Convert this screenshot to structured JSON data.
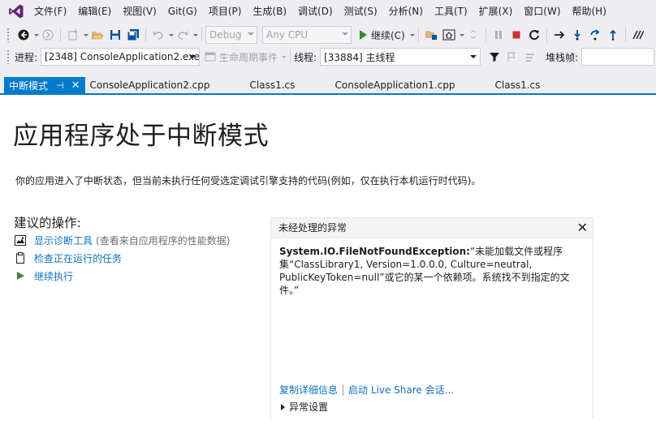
{
  "menu": [
    "文件(F)",
    "编辑(E)",
    "视图(V)",
    "Git(G)",
    "项目(P)",
    "生成(B)",
    "调试(D)",
    "测试(S)",
    "分析(N)",
    "工具(T)",
    "扩展(X)",
    "窗口(W)",
    "帮助(H)"
  ],
  "toolbar": {
    "config": "Debug",
    "platform": "Any CPU",
    "continue_label": "继续(C)"
  },
  "debug_location": {
    "process_label": "进程:",
    "process_value": "[2348] ConsoleApplication2.exe",
    "lifecycle_label": "生命周期事件",
    "thread_label": "线程:",
    "thread_value": "[33884] 主线程",
    "stackframe_label": "堆栈帧:"
  },
  "tabs": [
    {
      "label": "中断模式",
      "active": true
    },
    {
      "label": "ConsoleApplication2.cpp"
    },
    {
      "label": "Class1.cs"
    },
    {
      "label": "ConsoleApplication1.cpp"
    },
    {
      "label": "Class1.cs"
    }
  ],
  "page": {
    "title": "应用程序处于中断模式",
    "description": "你的应用进入了中断状态，但当前未执行任何受选定调试引擎支持的代码(例如，仅在执行本机运行时代码)。",
    "actions_heading": "建议的操作:",
    "actions": [
      {
        "label": "显示诊断工具",
        "hint": "(查看来自应用程序的性能数据)",
        "icon": "diagnostics-icon"
      },
      {
        "label": "检查正在运行的任务",
        "hint": "",
        "icon": "clipboard-icon"
      },
      {
        "label": "继续执行",
        "hint": "",
        "icon": "play-icon"
      }
    ]
  },
  "exception": {
    "header": "未经处理的异常",
    "type": "System.IO.FileNotFoundException:",
    "message": "“未能加载文件或程序集“ClassLibrary1, Version=1.0.0.0, Culture=neutral, PublicKeyToken=null”或它的某一个依赖项。系统找不到指定的文件。”",
    "copy_details": "复制详细信息",
    "live_share": "启动 Live Share 会话...",
    "settings": "异常设置"
  },
  "colors": {
    "accent": "#007acc",
    "link": "#0e70c0",
    "play_green": "#388a34",
    "stop_red": "#c5342c"
  }
}
